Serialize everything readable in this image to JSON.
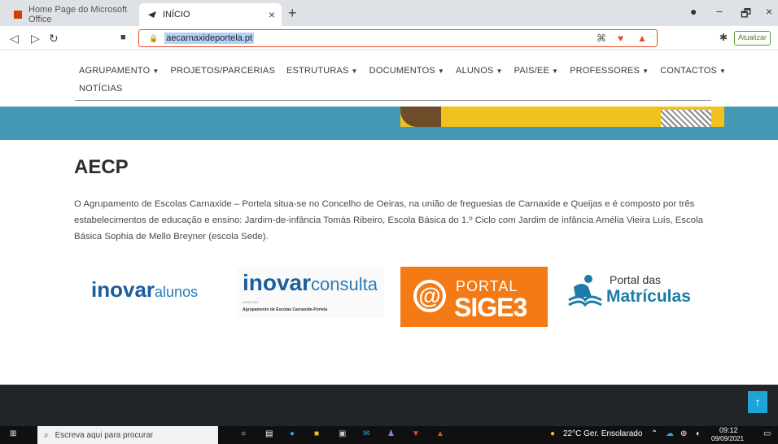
{
  "browser": {
    "tabs": [
      {
        "label": "Home Page do Microsoft Office",
        "active": false
      },
      {
        "label": "INÍCIO",
        "active": true
      }
    ],
    "new_tab": "+",
    "tab_close": "×",
    "url": "aecarnaxideportela.pt",
    "update_label": "Atualizar",
    "window_controls": [
      "●",
      "−",
      "🗗",
      "×"
    ]
  },
  "site": {
    "nav_row1": [
      "AGRUPAMENTO",
      "PROJETOS/PARCERIAS",
      "ESTRUTURAS",
      "DOCUMENTOS",
      "ALUNOS",
      "PAIS/EE",
      "PROFESSORES",
      "CONTACTOS"
    ],
    "nav_row2": [
      "NOTÍCIAS"
    ],
    "heading": "AECP",
    "paragraph": "O Agrupamento de Escolas Carnaxide – Portela situa-se no Concelho de Oeiras, na união de freguesias de Carnaxide e Queijas e é composto por três estabelecimentos de educação e ensino: Jardim-de-infância Tomás Ribeiro, Escola Básica do 1.º Ciclo com Jardim de infância Amélia Vieira Luís, Escola Básica  Sophia de Mello Breyner (escola Sede).",
    "logos": {
      "inovaralunos": {
        "bold": "inovar",
        "light": "alunos"
      },
      "inovarconsulta": {
        "bold": "inovar",
        "light": "consulta",
        "small": "v2015.140",
        "caption": "Agrupamento de Escolas Carnaxide-Portela"
      },
      "sige": {
        "portal": "PORTAL",
        "sige": "SIGE3",
        "at": "@"
      },
      "matriculas": {
        "line1": "Portal das",
        "line2": "Matrículas"
      }
    },
    "to_top": "↑"
  },
  "taskbar": {
    "search_placeholder": "Escreva aqui para procurar",
    "weather": "22°C  Ger. Ensolarado",
    "time": "09:12",
    "date": "09/09/2021"
  },
  "colors": {
    "banner": "#4498b5",
    "accent_orange": "#f47a16",
    "footer": "#222527"
  }
}
